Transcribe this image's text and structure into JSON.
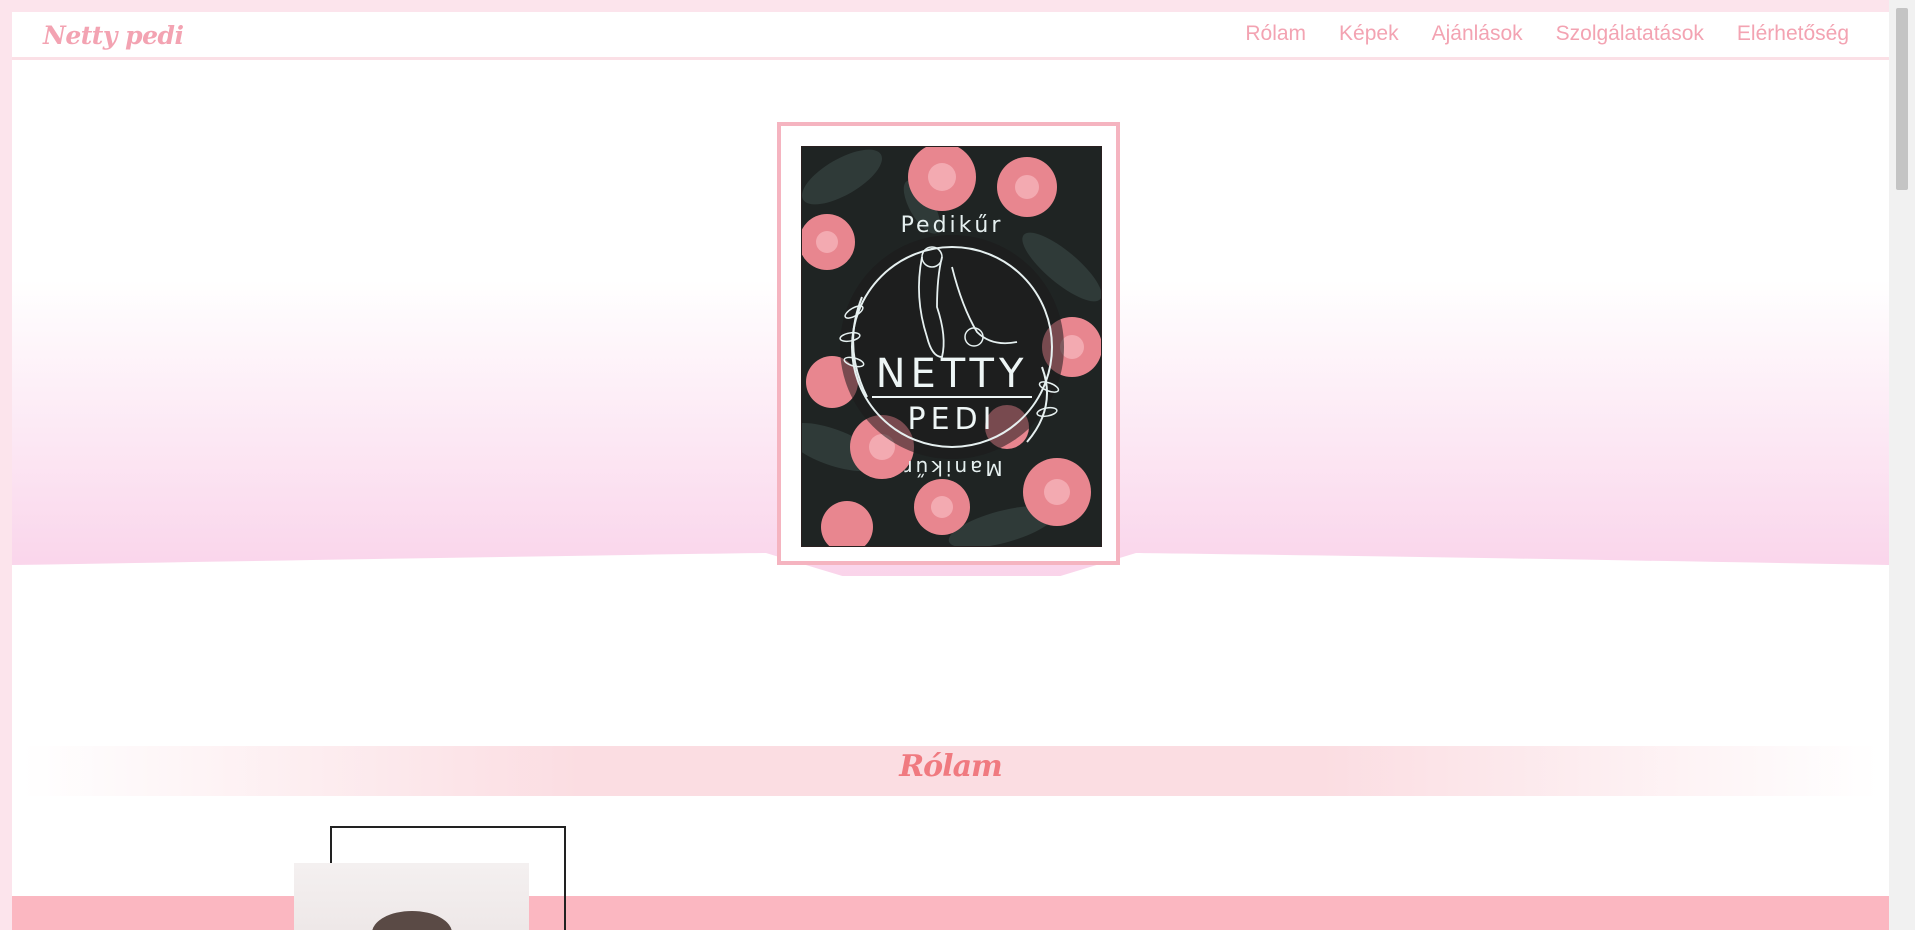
{
  "header": {
    "brand": "Netty pedi",
    "nav": [
      "Rólam",
      "Képek",
      "Ajánlások",
      "Szolgálatatások",
      "Elérhetőség"
    ]
  },
  "hero": {
    "logo": {
      "arc_top": "Pedikűr",
      "arc_bottom": "Manikűr",
      "name_main": "NETTY",
      "name_sub": "PEDI"
    }
  },
  "about": {
    "title": "Rólam"
  },
  "colors": {
    "accent": "#f3a3b2",
    "title": "#f07a80",
    "strip": "#fbb7c1",
    "hero_pink": "#f9cfe8"
  }
}
